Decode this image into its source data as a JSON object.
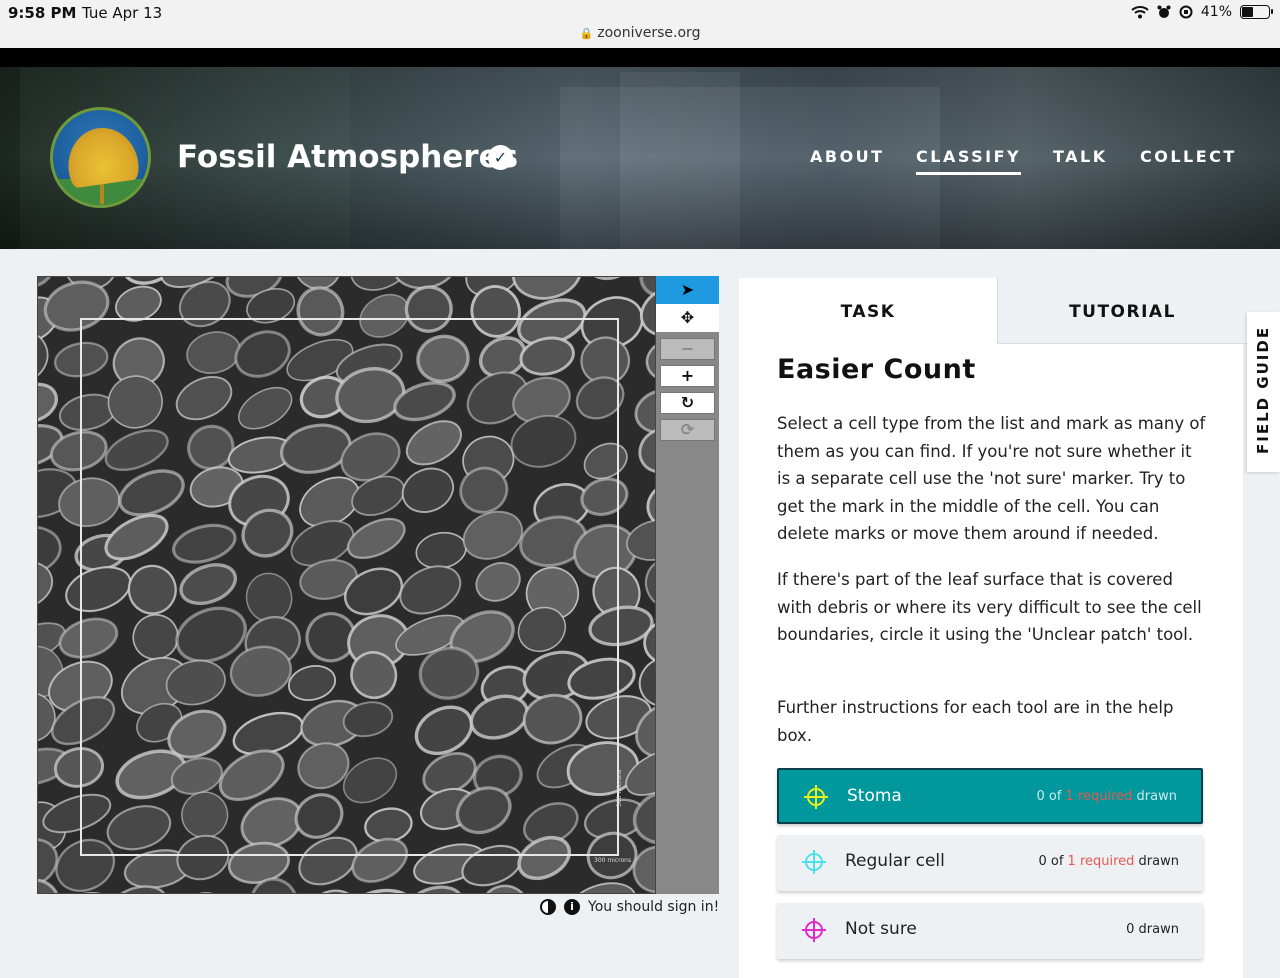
{
  "status_bar": {
    "time": "9:58 PM",
    "date": "Tue Apr 13",
    "url": "zooniverse.org",
    "battery": "41%",
    "battery_level": 0.41,
    "icons": [
      "wifi-icon",
      "alarm-icon",
      "orientation-lock-icon",
      "battery-icon"
    ]
  },
  "header": {
    "project_title": "Fossil Atmospheres",
    "verified_icon": "checkmark-badge-icon",
    "nav": [
      {
        "label": "ABOUT",
        "active": false
      },
      {
        "label": "CLASSIFY",
        "active": true
      },
      {
        "label": "TALK",
        "active": false
      },
      {
        "label": "COLLECT",
        "active": false
      }
    ]
  },
  "viewer": {
    "scale_label": "300 microns",
    "tools": {
      "pointer": "➤",
      "pan": "✥",
      "zoom_out": "−",
      "zoom_in": "+",
      "rotate": "↻",
      "reset": "⟳"
    },
    "sign_in_message": "You should sign in!",
    "invert_icon": "contrast-icon",
    "info_icon": "info-icon",
    "info_glyph": "i"
  },
  "panel": {
    "tabs": {
      "task": "TASK",
      "tutorial": "TUTORIAL"
    },
    "task_title": "Easier Count",
    "paragraphs": [
      "Select a cell type from the list and mark as many of them as you can find. If you're not sure whether it is a separate cell use the 'not sure' marker. Try to get the mark in the middle of the cell. You can delete marks or move them around if needed.",
      "If there's part of the leaf surface that is covered with debris or where its very difficult to see the cell boundaries, circle it using the 'Unclear patch' tool.",
      "Further instructions for each tool are in the help box."
    ],
    "tools": [
      {
        "label": "Stoma",
        "count_prefix": "0 of ",
        "required": "1 required",
        "count_suffix": " drawn",
        "color": "#e6f21b",
        "active": true
      },
      {
        "label": "Regular cell",
        "count_prefix": "0 of ",
        "required": "1 required",
        "count_suffix": " drawn",
        "color": "#4de0e8",
        "active": false
      },
      {
        "label": "Not sure",
        "count_prefix": "0 drawn",
        "required": "",
        "count_suffix": "",
        "color": "#e02ccf",
        "active": false
      }
    ]
  },
  "field_guide": {
    "label": "FIELD GUIDE"
  }
}
